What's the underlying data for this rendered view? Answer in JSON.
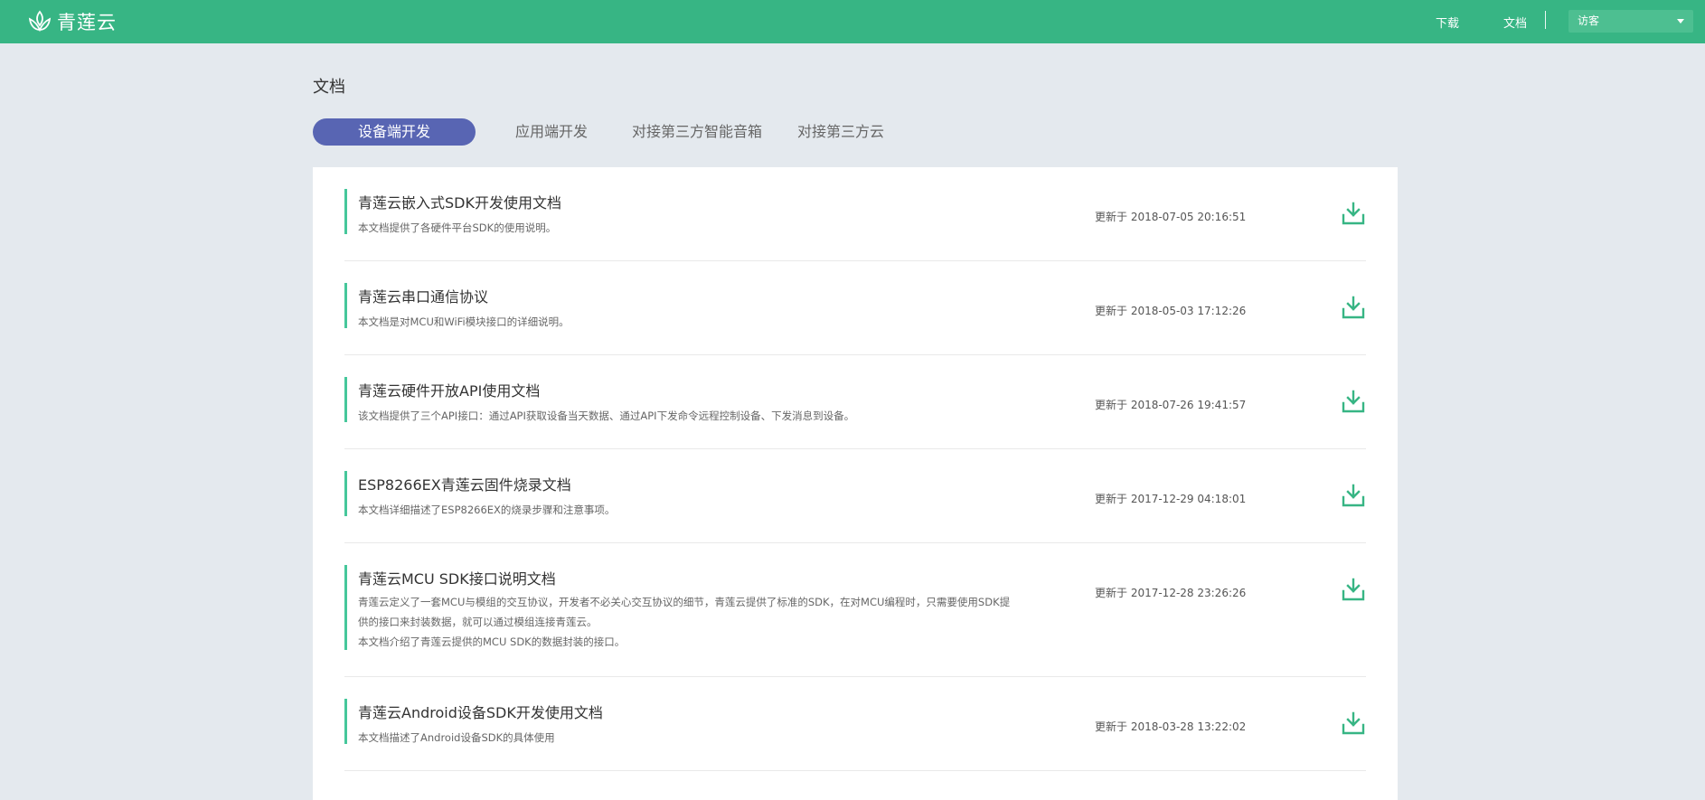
{
  "header": {
    "logo_text": "青莲云",
    "nav": [
      {
        "label": "下载"
      },
      {
        "label": "文档"
      }
    ],
    "user_select": "访客",
    "brand_color": "#37b584"
  },
  "page_title": "文档",
  "tabs": [
    {
      "label": "设备端开发",
      "active": true
    },
    {
      "label": "应用端开发",
      "active": false
    },
    {
      "label": "对接第三方智能音箱",
      "active": false
    },
    {
      "label": "对接第三方云",
      "active": false
    }
  ],
  "docs": [
    {
      "title": "青莲云嵌入式SDK开发使用文档",
      "desc": [
        "本文档提供了各硬件平台SDK的使用说明。"
      ],
      "updated": "更新于 2018-07-05 20:16:51"
    },
    {
      "title": "青莲云串口通信协议",
      "desc": [
        "本文档是对MCU和WiFi模块接口的详细说明。"
      ],
      "updated": "更新于 2018-05-03 17:12:26"
    },
    {
      "title": "青莲云硬件开放API使用文档",
      "desc": [
        "该文档提供了三个API接口：通过API获取设备当天数据、通过API下发命令远程控制设备、下发消息到设备。"
      ],
      "updated": "更新于 2018-07-26 19:41:57"
    },
    {
      "title": "ESP8266EX青莲云固件烧录文档",
      "desc": [
        "本文档详细描述了ESP8266EX的烧录步骤和注意事项。"
      ],
      "updated": "更新于 2017-12-29 04:18:01"
    },
    {
      "title": "青莲云MCU SDK接口说明文档",
      "desc": [
        "青莲云定义了一套MCU与模组的交互协议，开发者不必关心交互协议的细节，青莲云提供了标准的SDK，在对MCU编程时，只需要使用SDK提",
        "供的接口来封装数据，就可以通过模组连接青莲云。",
        "本文档介绍了青莲云提供的MCU SDK的数据封装的接口。"
      ],
      "updated": "更新于 2017-12-28 23:26:26"
    },
    {
      "title": "青莲云Android设备SDK开发使用文档",
      "desc": [
        "本文档描述了Android设备SDK的具体使用"
      ],
      "updated": "更新于 2018-03-28 13:22:02"
    }
  ],
  "icons": {
    "logo": "lotus-logo-icon",
    "download": "download-icon",
    "caret": "caret-down-icon"
  },
  "accent_color": "#46c79b",
  "tab_active_color": "#5865b3"
}
